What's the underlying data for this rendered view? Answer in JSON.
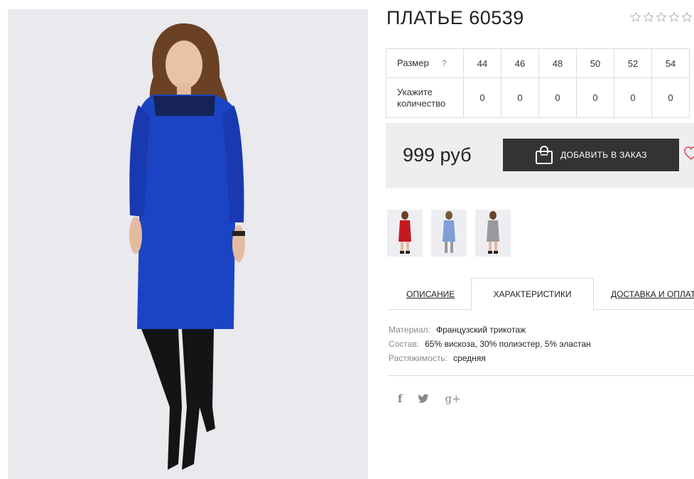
{
  "product": {
    "title": "ПЛАТЬЕ 60539",
    "rating_stars": 5,
    "rating_value": 0
  },
  "size_table": {
    "size_label": "Размер",
    "help_icon": "?",
    "quantity_label_line1": "Укажите",
    "quantity_label_line2": "количество",
    "sizes": [
      "44",
      "46",
      "48",
      "50",
      "52",
      "54"
    ],
    "quantities": [
      "0",
      "0",
      "0",
      "0",
      "0",
      "0"
    ]
  },
  "purchase": {
    "price": "999 руб",
    "add_button_label": "ДОБАВИТЬ В ЗАКАЗ",
    "button_icon": "shopping-bag-icon",
    "wishlist_icon": "heart-icon"
  },
  "thumbnails": [
    {
      "color_name": "red",
      "dress_color": "#c41820"
    },
    {
      "color_name": "light-blue",
      "dress_color": "#7f9fd6"
    },
    {
      "color_name": "grey",
      "dress_color": "#9a9a9c"
    }
  ],
  "tabs": [
    {
      "label": "ОПИСАНИЕ",
      "active": false
    },
    {
      "label": "ХАРАКТЕРИСТИКИ",
      "active": true
    },
    {
      "label": "ДОСТАВКА И ОПЛАТА",
      "active": false
    }
  ],
  "characteristics": [
    {
      "key": "Материал:",
      "value": "Французский трикотаж"
    },
    {
      "key": "Состав:",
      "value": "65% вискоза, 30% полиэстер, 5% эластан"
    },
    {
      "key": "Растяжимость:",
      "value": "средняя"
    }
  ],
  "social": {
    "facebook": "f",
    "twitter": "twitter-bird-icon",
    "google_plus": "g+"
  },
  "colors": {
    "main_dress": "#1b44c4",
    "button_bg": "#333333",
    "price_bg": "#eeeeee",
    "heart": "#e0566a"
  }
}
